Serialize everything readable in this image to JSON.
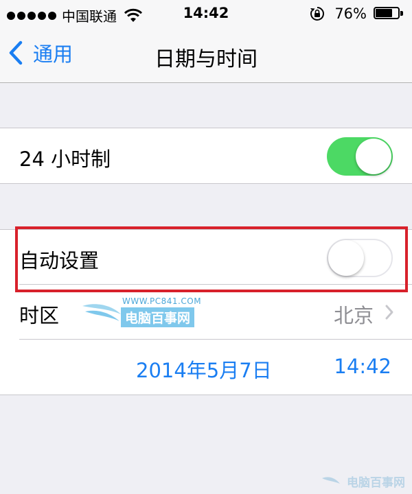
{
  "status_bar": {
    "carrier": "中国联通",
    "time": "14:42",
    "battery_percent_text": "76%",
    "battery_level": 0.76
  },
  "nav": {
    "back_label": "通用",
    "title": "日期与时间"
  },
  "settings": {
    "hour24": {
      "label": "24 小时制",
      "on": true
    },
    "auto_set": {
      "label": "自动设置",
      "on": false
    },
    "timezone": {
      "label": "时区",
      "value": "北京"
    },
    "datetime": {
      "date": "2014年5月7日",
      "time": "14:42"
    }
  },
  "watermark": {
    "url": "WWW.PC841.COM",
    "name": "电脑百事网"
  },
  "colors": {
    "accent": "#1a7ef2",
    "toggle_on": "#4cd964",
    "highlight": "#d8212b",
    "secondary_text": "#8e8e93"
  },
  "icons": [
    "signal-dots-icon",
    "wifi-icon",
    "rotation-lock-icon",
    "battery-icon",
    "back-chevron-icon",
    "chevron-right-icon"
  ]
}
